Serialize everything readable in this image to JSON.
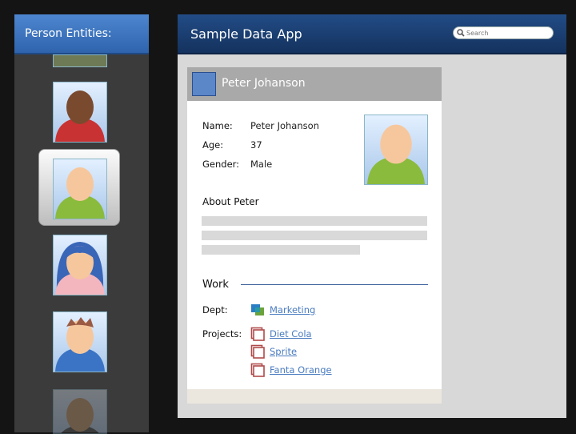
{
  "sidebar": {
    "title": "Person Entities:",
    "people": [
      {
        "name": "person-1",
        "skin": "#7a4a2e",
        "shirt": "#c83232"
      },
      {
        "name": "person-2",
        "skin": "#f6c79d",
        "shirt": "#8abb3c",
        "selected": true
      },
      {
        "name": "person-3",
        "skin": "#f6c79d",
        "shirt": "#f4b6be",
        "hair": "#3a66b8"
      },
      {
        "name": "person-4",
        "skin": "#f6c79d",
        "shirt": "#3b74c4",
        "hair": "#9b5a44"
      }
    ]
  },
  "header": {
    "app_title": "Sample Data App",
    "search_placeholder": "Search"
  },
  "card": {
    "title": "Peter Johanson",
    "name_label": "Name:",
    "name_value": "Peter Johanson",
    "age_label": "Age:",
    "age_value": "37",
    "gender_label": "Gender:",
    "gender_value": "Male",
    "about_heading": "About Peter",
    "work_heading": "Work",
    "dept_label": "Dept:",
    "dept_value": "Marketing",
    "projects_label": "Projects:",
    "projects": [
      "Diet Cola",
      "Sprite",
      "Fanta Orange"
    ]
  },
  "colors": {
    "left_header": "#3b75c0",
    "main_header": "#1c4178",
    "link": "#4a7cc0",
    "project_icon": "#b04a4a"
  }
}
